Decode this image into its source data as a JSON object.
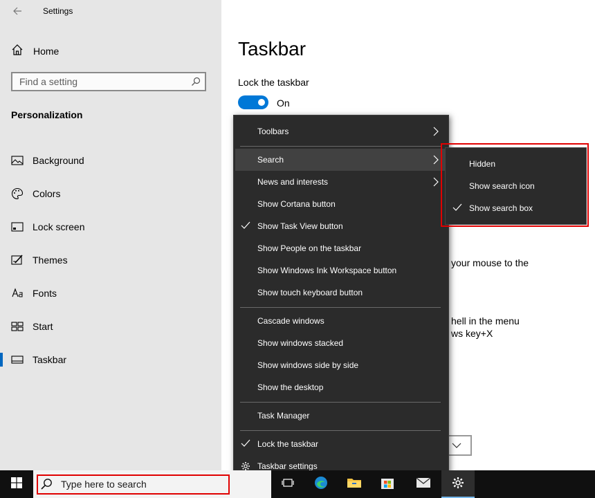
{
  "window": {
    "title": "Settings"
  },
  "sidebar": {
    "home_label": "Home",
    "search_placeholder": "Find a setting",
    "section_title": "Personalization",
    "items": [
      {
        "label": "Background",
        "icon": "image-icon"
      },
      {
        "label": "Colors",
        "icon": "palette-icon"
      },
      {
        "label": "Lock screen",
        "icon": "lock-screen-icon"
      },
      {
        "label": "Themes",
        "icon": "themes-icon"
      },
      {
        "label": "Fonts",
        "icon": "fonts-icon"
      },
      {
        "label": "Start",
        "icon": "start-icon"
      },
      {
        "label": "Taskbar",
        "icon": "taskbar-icon",
        "active": true
      }
    ]
  },
  "main": {
    "title": "Taskbar",
    "lock_label": "Lock the taskbar",
    "lock_state": "On",
    "partial_text_1": "your mouse to the",
    "partial_text_2": "hell in the menu",
    "partial_text_3": "ws key+X"
  },
  "context_menu": {
    "items": [
      {
        "label": "Toolbars",
        "submenu": true
      },
      {
        "label": "Search",
        "submenu": true,
        "highlighted": true
      },
      {
        "label": "News and interests",
        "submenu": true
      },
      {
        "label": "Show Cortana button"
      },
      {
        "label": "Show Task View button",
        "checked": true
      },
      {
        "label": "Show People on the taskbar"
      },
      {
        "label": "Show Windows Ink Workspace button"
      },
      {
        "label": "Show touch keyboard button"
      },
      {
        "label": "Cascade windows"
      },
      {
        "label": "Show windows stacked"
      },
      {
        "label": "Show windows side by side"
      },
      {
        "label": "Show the desktop"
      },
      {
        "label": "Task Manager"
      },
      {
        "label": "Lock the taskbar",
        "checked": true
      },
      {
        "label": "Taskbar settings",
        "icon": "gear-icon"
      }
    ]
  },
  "search_submenu": {
    "items": [
      {
        "label": "Hidden"
      },
      {
        "label": "Show search icon"
      },
      {
        "label": "Show search box",
        "checked": true
      }
    ]
  },
  "taskbar": {
    "search_placeholder": "Type here to search",
    "accent_color": "#76b9ed",
    "highlight_color": "#e00000"
  }
}
